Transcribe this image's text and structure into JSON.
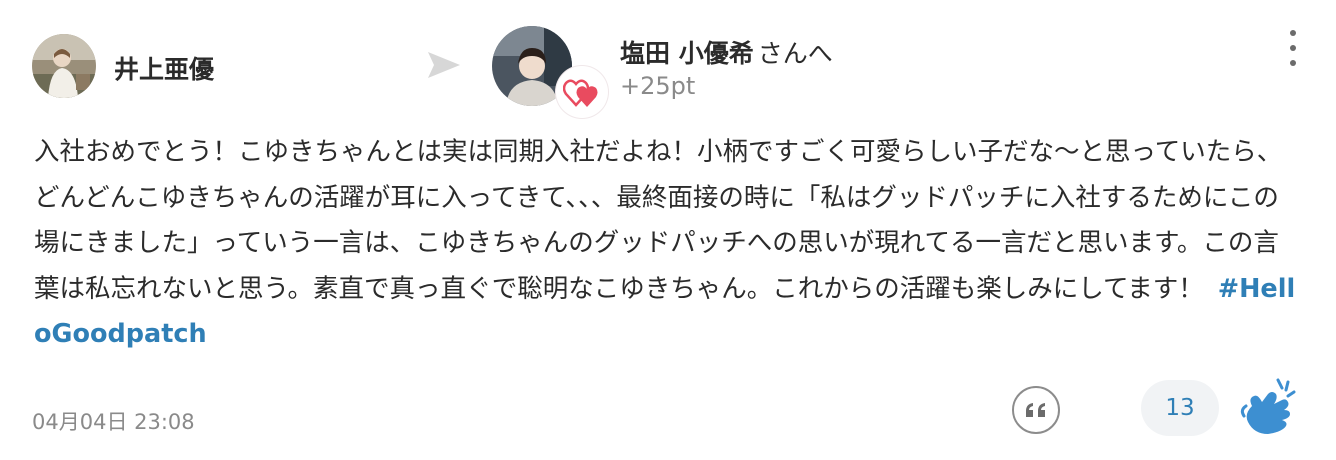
{
  "post": {
    "sender_name": "井上亜優",
    "recipient_name": "塩田 小優希",
    "recipient_suffix": "さんへ",
    "points": "+25pt",
    "message": "入社おめでとう！こゆきちゃんとは実は同期入社だよね！小柄ですごく可愛らしい子だな〜と思っていたら、どんどんこゆきちゃんの活躍が耳に入ってきて、、、最終面接の時に「私はグッドパッチに入社するためにこの場にきました」っていう一言は、こゆきちゃんのグッドパッチへの思いが現れてる一言だと思います。この言葉は私忘れないと思う。素直で真っ直ぐで聡明なこゆきちゃん。これからの活躍も楽しみにしてます！",
    "hashtag": "#HelloGoodpatch",
    "timestamp": "04月04日 23:08",
    "clap_count": "13"
  },
  "icons": {
    "sender_avatar": "user-photo-avatar",
    "recipient_avatar": "user-photo-avatar",
    "heart_badge": "hearts-icon",
    "arrow": "send-arrow-icon",
    "more": "vertical-ellipsis-icon",
    "quote": "quote-icon",
    "clap": "clapping-hands-icon"
  },
  "colors": {
    "hashtag": "#2f7fb6",
    "clap": "#3d8fd1",
    "heart": "#e94b5f",
    "muted_text": "#8a8a8a"
  }
}
